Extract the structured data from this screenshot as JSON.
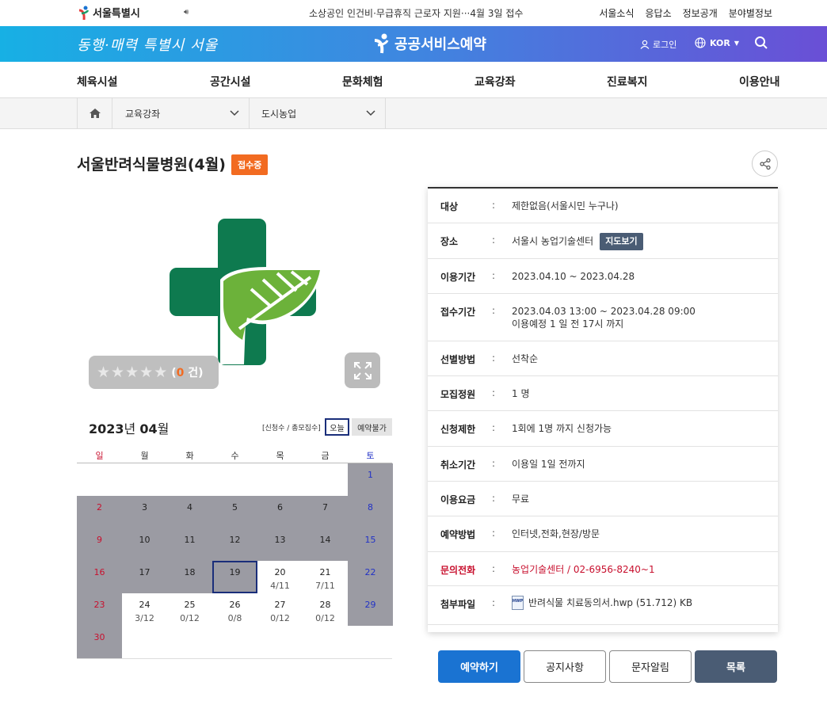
{
  "topbar": {
    "logo": "서울특별시",
    "notice": "소상공인 인건비·무급휴직 근로자 지원···4월 3일 접수",
    "links": [
      "서울소식",
      "응답소",
      "정보공개",
      "분야별정보"
    ]
  },
  "banner": {
    "slogan": "동행·매력 특별시 서울",
    "brand": "공공서비스예약",
    "login": "로그인",
    "lang": "KOR"
  },
  "gnb": [
    "체육시설",
    "공간시설",
    "문화체험",
    "교육강좌",
    "진료복지",
    "이용안내"
  ],
  "breadcrumb": {
    "level1": "교육강좌",
    "level2": "도시농업"
  },
  "page": {
    "title": "서울반려식물병원(4월)",
    "status": "접수중"
  },
  "rating": {
    "count_value": "0",
    "count_suffix": " 건)",
    "count_prefix": "("
  },
  "calendar": {
    "year": "2023",
    "year_unit": "년",
    "month": "04",
    "month_unit": "월",
    "legend": "[신청수 / 총모집수]",
    "today_label": "오늘",
    "view_label": "예약불가",
    "dow": [
      "일",
      "월",
      "화",
      "수",
      "목",
      "금",
      "토"
    ],
    "weeks": [
      [
        null,
        null,
        null,
        null,
        null,
        null,
        {
          "d": "1",
          "gray": true
        }
      ],
      [
        {
          "d": "2",
          "gray": true
        },
        {
          "d": "3",
          "gray": true
        },
        {
          "d": "4",
          "gray": true
        },
        {
          "d": "5",
          "gray": true
        },
        {
          "d": "6",
          "gray": true
        },
        {
          "d": "7",
          "gray": true
        },
        {
          "d": "8",
          "gray": true
        }
      ],
      [
        {
          "d": "9",
          "gray": true
        },
        {
          "d": "10",
          "gray": true
        },
        {
          "d": "11",
          "gray": true
        },
        {
          "d": "12",
          "gray": true
        },
        {
          "d": "13",
          "gray": true
        },
        {
          "d": "14",
          "gray": true
        },
        {
          "d": "15",
          "gray": true
        }
      ],
      [
        {
          "d": "16",
          "gray": true
        },
        {
          "d": "17",
          "gray": true
        },
        {
          "d": "18",
          "gray": true
        },
        {
          "d": "19",
          "gray": true,
          "today": true
        },
        {
          "d": "20",
          "sub": "4/11"
        },
        {
          "d": "21",
          "sub": "7/11"
        },
        {
          "d": "22",
          "gray": true
        }
      ],
      [
        {
          "d": "23",
          "gray": true
        },
        {
          "d": "24",
          "sub": "3/12"
        },
        {
          "d": "25",
          "sub": "0/12"
        },
        {
          "d": "26",
          "sub": "0/8"
        },
        {
          "d": "27",
          "sub": "0/12"
        },
        {
          "d": "28",
          "sub": "0/12"
        },
        {
          "d": "29",
          "gray": true
        }
      ],
      [
        {
          "d": "30",
          "gray": true
        },
        null,
        null,
        null,
        null,
        null,
        null
      ]
    ]
  },
  "info": [
    {
      "k": "대상",
      "v": "제한없음(서울시민 누구나)"
    },
    {
      "k": "장소",
      "v": "서울시 농업기술센터",
      "btn": "지도보기"
    },
    {
      "k": "이용기간",
      "v": "2023.04.10 ~ 2023.04.28"
    },
    {
      "k": "접수기간",
      "v": "2023.04.03 13:00 ~ 2023.04.28 09:00",
      "v2": "이용예정 1 일 전 17시 까지"
    },
    {
      "k": "선별방법",
      "v": "선착순"
    },
    {
      "k": "모집정원",
      "v": "1 명"
    },
    {
      "k": "신청제한",
      "v": "1회에 1명 까지 신청가능"
    },
    {
      "k": "취소기간",
      "v": "이용일 1일 전까지"
    },
    {
      "k": "이용요금",
      "v": "무료"
    },
    {
      "k": "예약방법",
      "v": "인터넷,전화,현장/방문"
    },
    {
      "k": "문의전화",
      "v": "농업기술센터 / 02-6956-8240~1",
      "red": true
    },
    {
      "k": "첨부파일",
      "v": "반려식물 치료동의서.hwp (51.712) KB",
      "file": true,
      "file_icon_text": "HWP"
    }
  ],
  "info_colon": ":",
  "buttons": [
    "예약하기",
    "공지사항",
    "문자알림",
    "목록"
  ],
  "colors": {
    "accent": "#1a73d2",
    "status": "#f26b21",
    "dark": "#4a5c74",
    "green": "#0e7a4f",
    "leaf": "#6cb23a"
  }
}
